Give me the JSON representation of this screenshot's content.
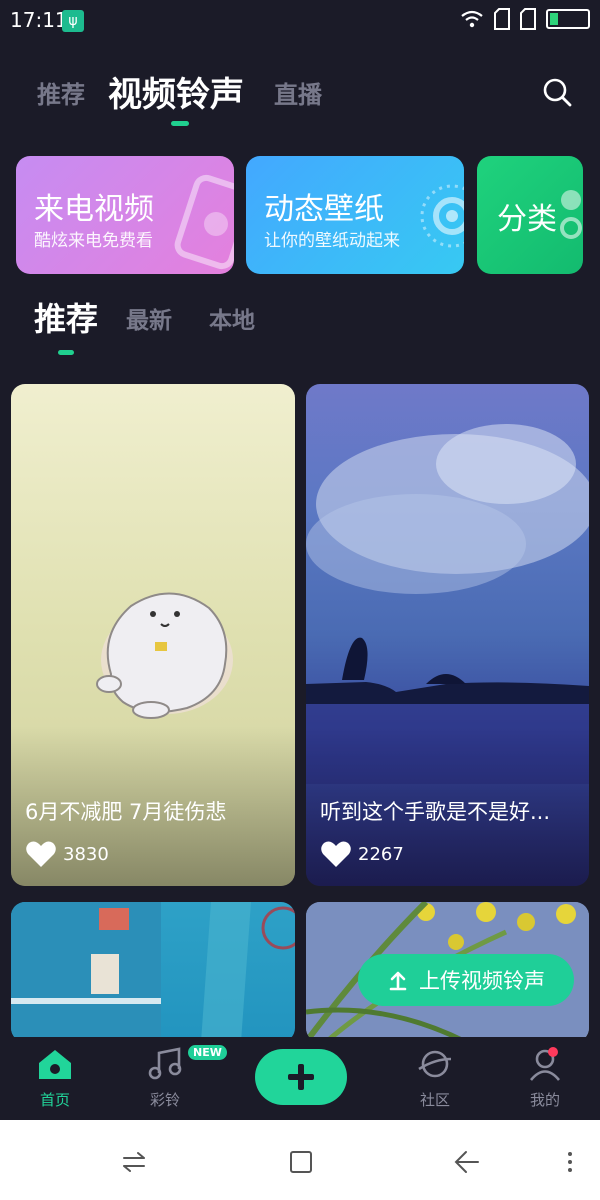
{
  "status_bar": {
    "time": "17:11"
  },
  "top_tabs": {
    "recommend": "推荐",
    "video_ringtone": "视频铃声",
    "live": "直播"
  },
  "feature_cards": [
    {
      "title": "来电视频",
      "subtitle": "酷炫来电免费看"
    },
    {
      "title": "动态壁纸",
      "subtitle": "让你的壁纸动起来"
    },
    {
      "title": "分类"
    }
  ],
  "sub_tabs": {
    "recommend": "推荐",
    "latest": "最新",
    "local": "本地"
  },
  "videos": [
    {
      "title": "6月不减肥 7月徒伤悲",
      "likes": "3830"
    },
    {
      "title": "听到这个手歌是不是好...",
      "likes": "2267"
    }
  ],
  "upload_button": {
    "label": "上传视频铃声"
  },
  "bottom_nav": {
    "home": "首页",
    "ringtone": "彩铃",
    "new_badge": "NEW",
    "community": "社区",
    "mine": "我的"
  },
  "colors": {
    "accent": "#21d59a",
    "background": "#1b1b28"
  }
}
